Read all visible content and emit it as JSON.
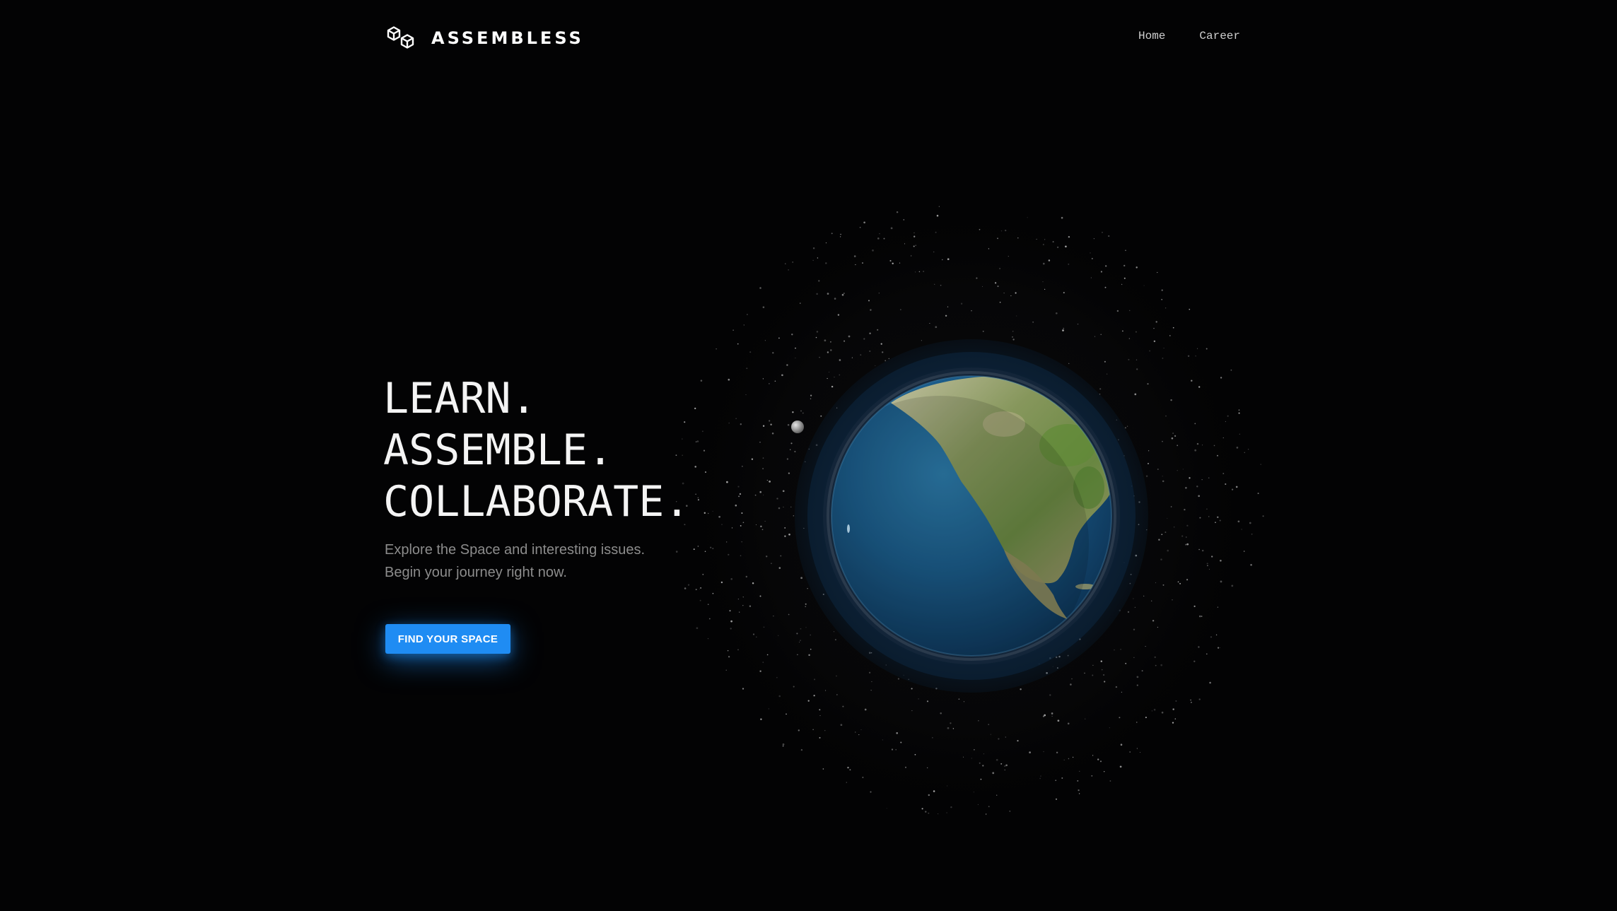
{
  "brand": {
    "name": "ASSEMBLESS",
    "logo_icon": "cubes-icon"
  },
  "nav": {
    "items": [
      {
        "label": "Home"
      },
      {
        "label": "Career"
      }
    ]
  },
  "hero": {
    "title_lines": [
      "LEARN.",
      "ASSEMBLE.",
      "COLLABORATE."
    ],
    "subtitle_lines": [
      "Explore the Space and interesting issues.",
      "Begin your journey right now."
    ],
    "cta_label": "FIND YOUR SPACE"
  },
  "colors": {
    "background": "#030304",
    "accent": "#1f8cf3",
    "subtitle": "#8c8c8c"
  }
}
